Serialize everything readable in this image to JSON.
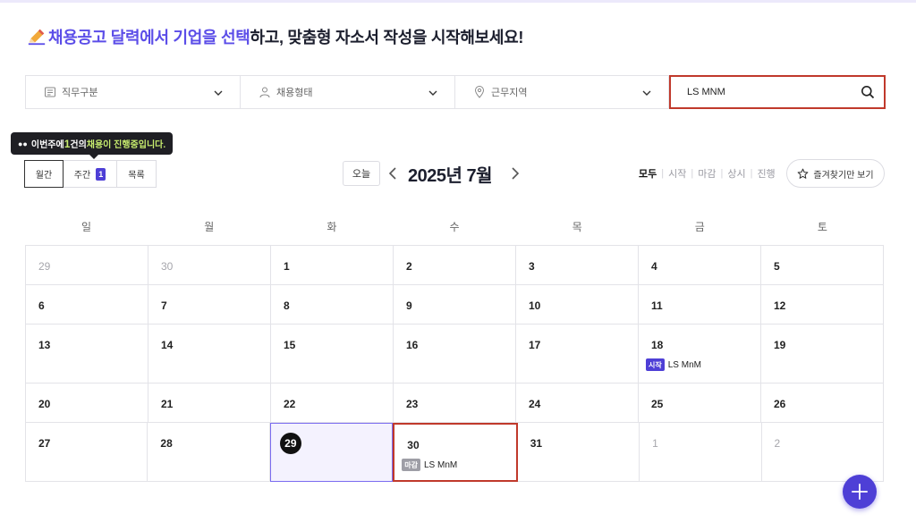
{
  "headline": {
    "accent": "채용공고 달력에서 기업을 선택",
    "rest": "하고, 맞춤형 자소서 작성을 시작해보세요!"
  },
  "filters": [
    {
      "label": "직무구분",
      "icon": "job-category-icon"
    },
    {
      "label": "채용형태",
      "icon": "person-icon"
    },
    {
      "label": "근무지역",
      "icon": "location-pin-icon"
    }
  ],
  "search": {
    "value": "LS MNM",
    "placeholder": ""
  },
  "tooltip": {
    "prefix": "이번주에 ",
    "count": "1",
    "middle": "건의",
    "highlight": " 채용이 진행중입니다."
  },
  "view_tabs": {
    "month": "월간",
    "week": "주간",
    "week_badge": "1",
    "list": "목록"
  },
  "nav": {
    "today": "오늘",
    "month_title": "2025년 7월"
  },
  "status_filters": {
    "all": "모두",
    "start": "시작",
    "deadline": "마감",
    "always": "상시",
    "ongoing": "진행"
  },
  "favorites_label": "즐겨찾기만 보기",
  "weekdays": [
    "일",
    "월",
    "화",
    "수",
    "목",
    "금",
    "토"
  ],
  "calendar": {
    "weeks": [
      [
        "29",
        "30",
        "1",
        "2",
        "3",
        "4",
        "5"
      ],
      [
        "6",
        "7",
        "8",
        "9",
        "10",
        "11",
        "12"
      ],
      [
        "13",
        "14",
        "15",
        "16",
        "17",
        "18",
        "19"
      ],
      [
        "20",
        "21",
        "22",
        "23",
        "24",
        "25",
        "26"
      ],
      [
        "27",
        "28",
        "29",
        "30",
        "31",
        "1",
        "2"
      ]
    ],
    "events": {
      "start": {
        "tag": "시작",
        "company": "LS MnM"
      },
      "deadline": {
        "tag": "마감",
        "company": "LS MnM"
      }
    }
  },
  "colors": {
    "accent": "#5b4de8",
    "brand": "#4e3fd6",
    "highlight_border": "#c0392b",
    "today_bg": "#f4f2fe"
  }
}
